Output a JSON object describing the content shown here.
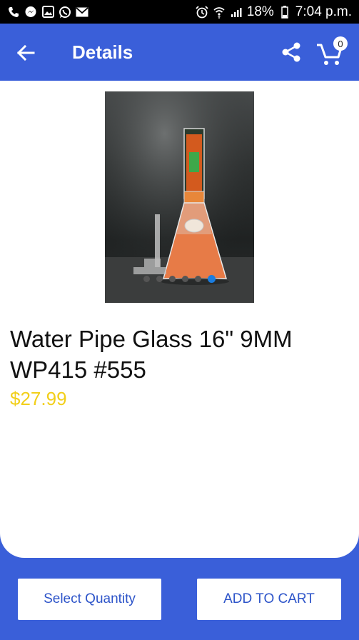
{
  "status_bar": {
    "battery_percent": "18%",
    "time": "7:04 p.m.",
    "left_icons": [
      "phone-icon",
      "messenger-icon",
      "gallery-icon",
      "whatsapp-icon",
      "mail-icon"
    ],
    "right_icons": [
      "alarm-icon",
      "wifi-icon",
      "signal-icon",
      "battery-icon"
    ]
  },
  "app_bar": {
    "title": "Details",
    "cart_count": "0",
    "color": "#3a5fd9"
  },
  "product": {
    "name": "Water Pipe Glass 16\" 9MM WP415 #555",
    "price": "$27.99",
    "image_count": 6,
    "active_image_index": 5,
    "price_color": "#f2cf1a"
  },
  "actions": {
    "select_quantity_label": "Select Quantity",
    "add_to_cart_label": "ADD TO CART"
  }
}
